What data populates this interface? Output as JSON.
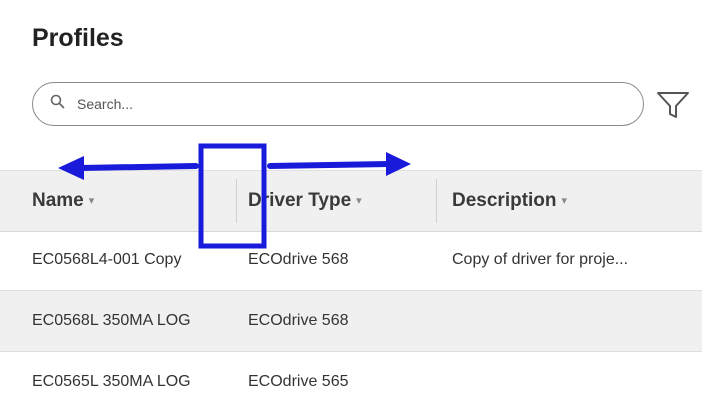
{
  "page": {
    "title": "Profiles"
  },
  "search": {
    "placeholder": "Search..."
  },
  "table": {
    "columns": [
      {
        "label": "Name",
        "caret": "▾"
      },
      {
        "label": "Driver Type",
        "caret": "▾"
      },
      {
        "label": "Description",
        "caret": "▾"
      }
    ],
    "rows": [
      {
        "name": "EC0568L4-001 Copy",
        "driver_type": "ECOdrive 568",
        "description": "Copy of driver for proje..."
      },
      {
        "name": "EC0568L 350MA LOG",
        "driver_type": "ECOdrive 568",
        "description": ""
      },
      {
        "name": "EC0565L 350MA LOG",
        "driver_type": "ECOdrive 565",
        "description": ""
      }
    ]
  },
  "colors": {
    "annotation": "#1a1adb",
    "header_bg": "#f0f0f0",
    "alt_row_bg": "#f0f0f0"
  },
  "icons": {
    "search": "search-icon",
    "filter": "filter-icon"
  }
}
